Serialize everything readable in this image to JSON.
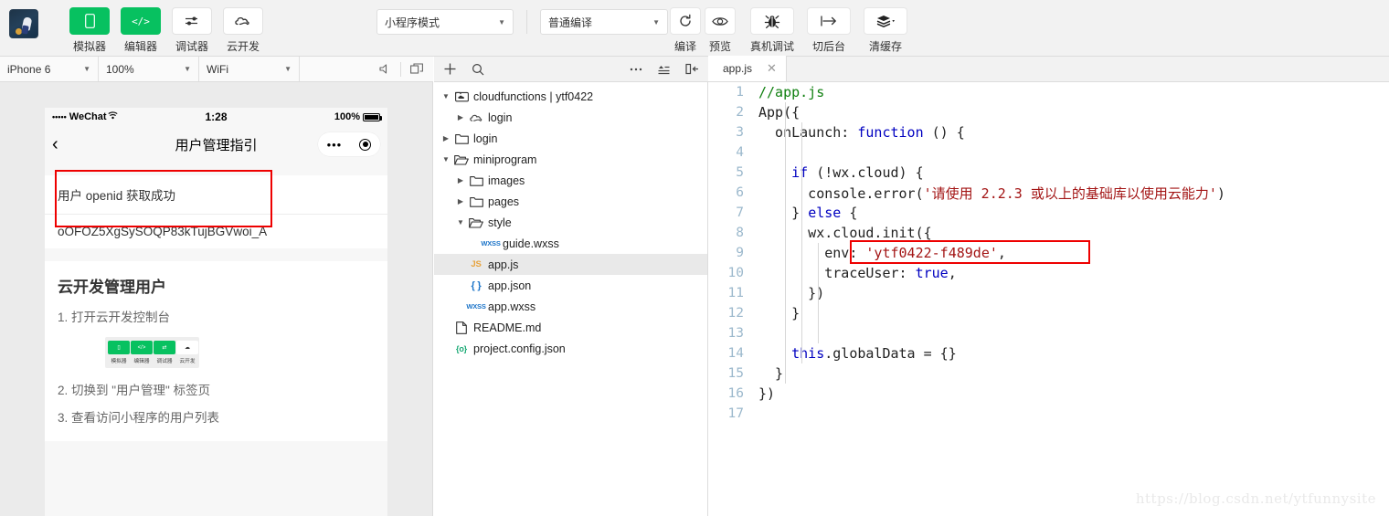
{
  "toolbar": {
    "avatar_name": "project-avatar",
    "main_buttons": [
      {
        "label": "模拟器",
        "icon": "simulator-icon",
        "style": "green",
        "glyph": "▯"
      },
      {
        "label": "编辑器",
        "icon": "editor-code-icon",
        "style": "green",
        "glyph": "</>"
      },
      {
        "label": "调试器",
        "icon": "debugger-sliders-icon",
        "style": "white",
        "glyph": "⇄"
      },
      {
        "label": "云开发",
        "icon": "cloud-dev-icon",
        "style": "white",
        "glyph": "☁"
      }
    ],
    "mode_select": {
      "value": "小程序模式",
      "icon": "chevron-down-icon"
    },
    "compile_select": {
      "value": "普通编译",
      "icon": "chevron-down-icon"
    },
    "action_buttons": [
      {
        "label": "编译",
        "icon": "refresh-compile-icon"
      },
      {
        "label": "预览",
        "icon": "eye-preview-icon"
      },
      {
        "label": "真机调试",
        "icon": "bug-remote-debug-icon"
      },
      {
        "label": "切后台",
        "icon": "background-switch-icon"
      },
      {
        "label": "清缓存",
        "icon": "clear-cache-layers-icon"
      }
    ]
  },
  "simulator_bar": {
    "device": "iPhone 6",
    "zoom": "100%",
    "network": "WiFi",
    "icons": [
      "volume-icon",
      "detach-window-icon"
    ]
  },
  "explorer_bar": {
    "icons": [
      "add-file-icon",
      "search-icon",
      "more-icon",
      "collapse-list-icon",
      "collapse-panel-icon"
    ]
  },
  "editor_tabs": [
    {
      "label": "app.js",
      "close_icon": "close-icon",
      "active": true
    }
  ],
  "phone": {
    "status": {
      "signal_dots": "•••••",
      "carrier": "WeChat",
      "wifi_icon": "wifi-icon",
      "time": "1:28",
      "battery_percent": "100%"
    },
    "nav": {
      "back_icon": "back-chevron-icon",
      "title": "用户管理指引",
      "capsule_more_icon": "more-dots-icon",
      "capsule_close_icon": "target-circle-icon"
    },
    "result_card": {
      "message": "用户 openid 获取成功",
      "openid": "oOFOZ5XgSySOQP83kTujBGVwoi_A"
    },
    "section": {
      "title": "云开发管理用户",
      "step1": "1. 打开云开发控制台",
      "mini_toolbar": [
        {
          "label": "模拟器",
          "style": "green",
          "glyph": "▯"
        },
        {
          "label": "编辑器",
          "style": "green",
          "glyph": "</>"
        },
        {
          "label": "调试器",
          "style": "green",
          "glyph": "⇄"
        },
        {
          "label": "云开发",
          "style": "white",
          "glyph": "☁"
        }
      ],
      "step2": "2. 切换到 \"用户管理\" 标签页",
      "step3": "3. 查看访问小程序的用户列表"
    }
  },
  "file_tree": [
    {
      "label": "cloudfunctions | ytf0422",
      "indent": 0,
      "twisty": "▼",
      "icon": "cloud-folder-icon",
      "selected": false
    },
    {
      "label": "login",
      "indent": 1,
      "twisty": "▶",
      "icon": "cloud-function-icon",
      "selected": false
    },
    {
      "label": "login",
      "indent": 0,
      "twisty": "▶",
      "icon": "folder-icon",
      "selected": false
    },
    {
      "label": "miniprogram",
      "indent": 0,
      "twisty": "▼",
      "icon": "folder-open-icon",
      "selected": false
    },
    {
      "label": "images",
      "indent": 1,
      "twisty": "▶",
      "icon": "folder-icon",
      "selected": false
    },
    {
      "label": "pages",
      "indent": 1,
      "twisty": "▶",
      "icon": "folder-icon",
      "selected": false
    },
    {
      "label": "style",
      "indent": 1,
      "twisty": "▼",
      "icon": "folder-open-icon",
      "selected": false
    },
    {
      "label": "guide.wxss",
      "indent": 2,
      "twisty": "",
      "icon": "wxss-file-icon",
      "selected": false
    },
    {
      "label": "app.js",
      "indent": 1,
      "twisty": "",
      "icon": "js-file-icon",
      "selected": true
    },
    {
      "label": "app.json",
      "indent": 1,
      "twisty": "",
      "icon": "json-file-icon",
      "selected": false
    },
    {
      "label": "app.wxss",
      "indent": 1,
      "twisty": "",
      "icon": "wxss-file-icon",
      "selected": false
    },
    {
      "label": "README.md",
      "indent": 0,
      "twisty": "",
      "icon": "markdown-file-icon",
      "selected": false
    },
    {
      "label": "project.config.json",
      "indent": 0,
      "twisty": "",
      "icon": "config-file-icon",
      "selected": false
    }
  ],
  "code": {
    "lines": [
      {
        "n": "1",
        "html": "<span class=\"cmt\">//app.js</span>"
      },
      {
        "n": "2",
        "html": "<span class=\"plain\">App({</span>"
      },
      {
        "n": "3",
        "html": "<span class=\"plain\">  onLaunch: </span><span class=\"kw\">function</span><span class=\"plain\"> () {</span>"
      },
      {
        "n": "4",
        "html": ""
      },
      {
        "n": "5",
        "html": "<span class=\"plain\">    </span><span class=\"kw\">if</span><span class=\"plain\"> (!wx.cloud) {</span>"
      },
      {
        "n": "6",
        "html": "<span class=\"plain\">      console.error(</span><span class=\"str\">'请使用 2.2.3 或以上的基础库以使用云能力'</span><span class=\"plain\">)</span>"
      },
      {
        "n": "7",
        "html": "<span class=\"plain\">    } </span><span class=\"kw\">else</span><span class=\"plain\"> {</span>"
      },
      {
        "n": "8",
        "html": "<span class=\"plain\">      wx.cloud.init({</span>"
      },
      {
        "n": "9",
        "html": "<span class=\"plain\">        env: </span><span class=\"str\">'ytf0422-f489de'</span><span class=\"plain\">,</span>"
      },
      {
        "n": "10",
        "html": "<span class=\"plain\">        traceUser: </span><span class=\"kw\">true</span><span class=\"plain\">,</span>"
      },
      {
        "n": "11",
        "html": "<span class=\"plain\">      })</span>"
      },
      {
        "n": "12",
        "html": "<span class=\"plain\">    }</span>"
      },
      {
        "n": "13",
        "html": ""
      },
      {
        "n": "14",
        "html": "<span class=\"plain\">    </span><span class=\"kw\">this</span><span class=\"plain\">.globalData = {}</span>"
      },
      {
        "n": "15",
        "html": "<span class=\"plain\">  }</span>"
      },
      {
        "n": "16",
        "html": "<span class=\"plain\">})</span>"
      },
      {
        "n": "17",
        "html": ""
      }
    ]
  },
  "annotations": {
    "color": "#ee0000",
    "boxes": [
      "openid-result-highlight",
      "env-config-highlight"
    ]
  },
  "watermark": "https://blog.csdn.net/ytfunnysite"
}
